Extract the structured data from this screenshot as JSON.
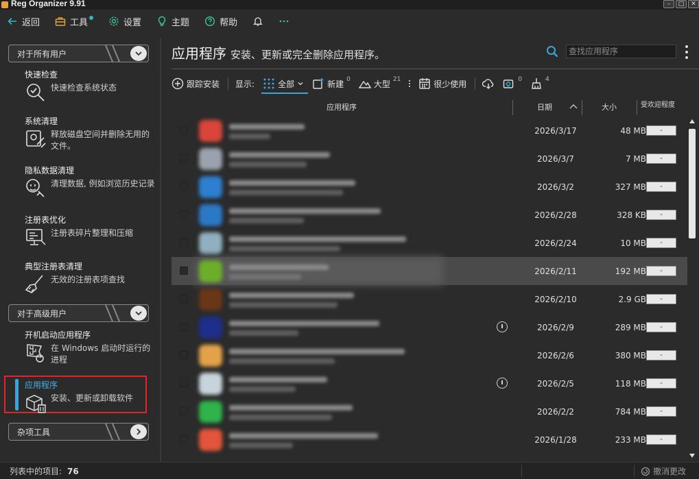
{
  "window": {
    "title": "Reg Organizer 9.91"
  },
  "menu": {
    "back": "返回",
    "tools": "工具",
    "settings": "设置",
    "theme": "主题",
    "help": "帮助"
  },
  "sidebar": {
    "section_all": "对于所有用户",
    "section_advanced": "对于高级用户",
    "section_misc": "杂项工具",
    "items": [
      {
        "title": "快速检查",
        "desc": "快速检查系统状态",
        "icon": "magnifier-check-icon"
      },
      {
        "title": "系统清理",
        "desc": "释放磁盘空间并删除无用的文件。",
        "icon": "disk-cleanup-icon"
      },
      {
        "title": "隐私数据清理",
        "desc": "清理数据, 例如浏览历史记录",
        "icon": "privacy-broom-icon"
      },
      {
        "title": "注册表优化",
        "desc": "注册表碎片整理和压缩",
        "icon": "registry-optimize-icon"
      },
      {
        "title": "典型注册表清理",
        "desc": "无效的注册表项查找",
        "icon": "registry-broom-icon"
      },
      {
        "title": "开机启动应用程序",
        "desc": "在 Windows 启动时运行的进程",
        "icon": "startup-flag-icon"
      },
      {
        "title": "应用程序",
        "desc": "安装、更新或卸载软件",
        "icon": "box-trash-icon"
      }
    ]
  },
  "main": {
    "title": "应用程序",
    "subtitle": "安装、更新或完全删除应用程序。",
    "search_placeholder": "查找应用程序",
    "toolbar": {
      "track_install": "跟踪安装",
      "show_label": "显示:",
      "all": "全部",
      "new": "新建",
      "new_count": "0",
      "large": "大型",
      "large_count": "21",
      "rarely_used": "很少使用",
      "shield_count": "0",
      "clean_count": "4"
    },
    "columns": {
      "app": "应用程序",
      "date": "日期",
      "size": "大小",
      "popular": "受欢迎程度"
    },
    "rows": [
      {
        "date": "2026/3/17",
        "size": "48 MB",
        "popular": "-",
        "color": "#d9453a",
        "info": false
      },
      {
        "date": "2026/3/7",
        "size": "7 MB",
        "popular": "-",
        "color": "#9aa3ad",
        "info": false
      },
      {
        "date": "2026/3/2",
        "size": "327 MB",
        "popular": "-",
        "color": "#2d7fcf",
        "info": false
      },
      {
        "date": "2026/2/28",
        "size": "328 KB",
        "popular": "-",
        "color": "#2b78c4",
        "info": false
      },
      {
        "date": "2026/2/24",
        "size": "10 MB",
        "popular": "-",
        "color": "#8fb0c0",
        "info": false
      },
      {
        "date": "2026/2/11",
        "size": "192 MB",
        "popular": "-",
        "color": "#6cae2a",
        "info": false,
        "highlight": true
      },
      {
        "date": "2026/2/10",
        "size": "2.9 GB",
        "popular": "-",
        "color": "#6a3618",
        "info": false
      },
      {
        "date": "2026/2/9",
        "size": "289 MB",
        "popular": "-",
        "color": "#1d2e8c",
        "info": true
      },
      {
        "date": "2026/2/6",
        "size": "380 MB",
        "popular": "-",
        "color": "#e2a24a",
        "info": false
      },
      {
        "date": "2026/2/5",
        "size": "118 MB",
        "popular": "-",
        "color": "#c8d4dc",
        "info": true
      },
      {
        "date": "2026/2/2",
        "size": "784 MB",
        "popular": "-",
        "color": "#2fb34a",
        "info": false
      },
      {
        "date": "2026/1/28",
        "size": "233 MB",
        "popular": "-",
        "color": "#e2553a",
        "info": false
      }
    ]
  },
  "status": {
    "items_label": "列表中的项目:",
    "items_count": "76",
    "undo": "撤消更改"
  }
}
